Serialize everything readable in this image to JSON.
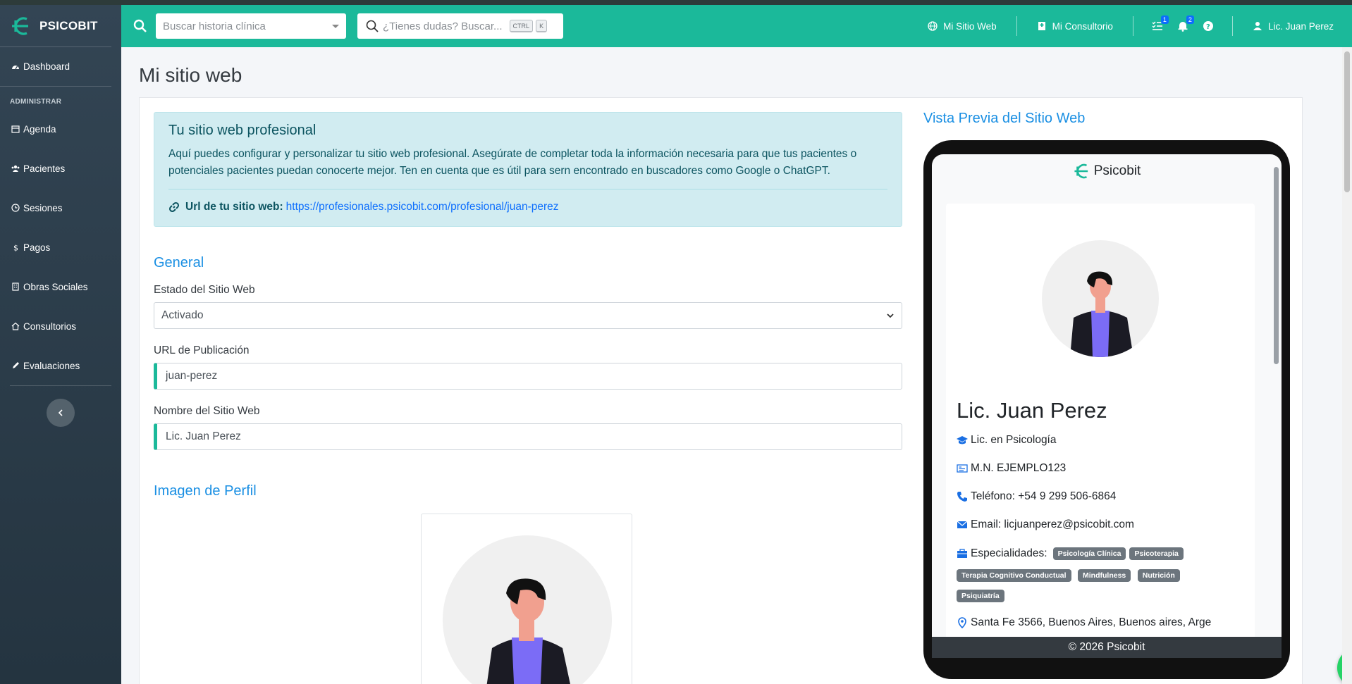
{
  "brand": {
    "name": "PSICOBIT"
  },
  "sidebar": {
    "section_header": "ADMINISTRAR",
    "items": [
      {
        "label": "Dashboard",
        "icon": "dashboard-icon"
      },
      {
        "label": "Agenda",
        "icon": "calendar-icon"
      },
      {
        "label": "Pacientes",
        "icon": "users-icon"
      },
      {
        "label": "Sesiones",
        "icon": "clock-icon"
      },
      {
        "label": "Pagos",
        "icon": "dollar-icon"
      },
      {
        "label": "Obras Sociales",
        "icon": "building-icon"
      },
      {
        "label": "Consultorios",
        "icon": "home-icon"
      },
      {
        "label": "Evaluaciones",
        "icon": "pencil-icon"
      }
    ]
  },
  "topbar": {
    "history_search_placeholder": "Buscar historia clínica",
    "doubt_search_placeholder": "¿Tienes dudas? Buscar...",
    "shortcut_ctrl": "CTRL",
    "shortcut_k": "K",
    "site_link": "Mi Sitio Web",
    "office_link": "Mi Consultorio",
    "tasks_badge": "1",
    "notifications_badge": "2",
    "user_name": "Lic. Juan Perez"
  },
  "page": {
    "title": "Mi sitio web"
  },
  "info": {
    "title": "Tu sitio web profesional",
    "text": "Aquí puedes configurar y personalizar tu sitio web profesional. Asegúrate de completar toda la información necesaria para que tus pacientes o potenciales pacientes puedan conocerte mejor. Ten en cuenta que es útil para sern encontrado en buscadores como Google o ChatGPT.",
    "url_label": "Url de tu sitio web:",
    "url": "https://profesionales.psicobit.com/profesional/juan-perez"
  },
  "general": {
    "title": "General",
    "status_label": "Estado del Sitio Web",
    "status_value": "Activado",
    "url_label": "URL de Publicación",
    "url_value": "juan-perez",
    "name_label": "Nombre del Sitio Web",
    "name_value": "Lic. Juan Perez"
  },
  "profile_image": {
    "title": "Imagen de Perfil"
  },
  "preview": {
    "title": "Vista Previa del Sitio Web",
    "brand": "Psicobit",
    "name": "Lic. Juan Perez",
    "degree": "Lic. en Psicología",
    "license": "M.N. EJEMPLO123",
    "phone": "Teléfono: +54 9 299 506-6864",
    "email": "Email: licjuanperez@psicobit.com",
    "specialties_label": "Especialidades:",
    "specialties": [
      "Psicología Clínica",
      "Psicoterapia",
      "Terapia Cognitivo Conductual",
      "Mindfulness",
      "Nutrición",
      "Psiquiatría"
    ],
    "address": "Santa Fe 3566, Buenos Aires, Buenos aires, Arge",
    "footer": "© 2026 Psicobit"
  },
  "colors": {
    "primary": "#1bb99a",
    "sidebar": "#2c3e4c",
    "accent_blue": "#1a8fe3"
  }
}
